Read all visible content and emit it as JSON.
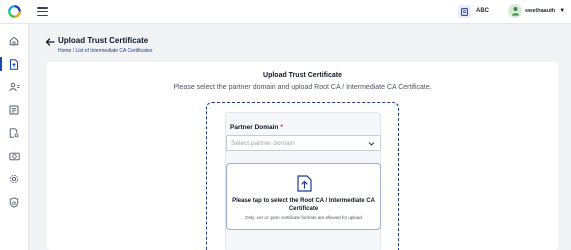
{
  "topbar": {
    "logo_icon": "colorful-ring-logo-icon",
    "menu_icon": "hamburger-menu-icon",
    "org_icon": "document-icon",
    "org_label": "ABC",
    "user_icon": "user-avatar-icon",
    "username": "swethaauth",
    "caret": "▼"
  },
  "sidebar": {
    "items": [
      {
        "icon": "home-icon",
        "active": false
      },
      {
        "icon": "file-upload-icon",
        "active": true
      },
      {
        "icon": "users-icon",
        "active": false
      },
      {
        "icon": "document-list-icon",
        "active": false
      },
      {
        "icon": "document-settings-icon",
        "active": false
      },
      {
        "icon": "camera-icon",
        "active": false
      },
      {
        "icon": "settings-icon",
        "active": false
      },
      {
        "icon": "shield-icon",
        "active": false
      }
    ]
  },
  "header": {
    "title": "Upload Trust Certificate",
    "breadcrumb_home": "Home",
    "breadcrumb_sep": " / ",
    "breadcrumb_current": "List of Intermediate CA Certificates"
  },
  "form": {
    "title": "Upload Trust Certificate",
    "subtitle": "Please select the partner domain and upload Root CA / Intermediate CA Certificate.",
    "partner_domain_label": "Partner Domain",
    "required_mark": "*",
    "select_placeholder": "Select partner domain",
    "upload_line1": "Please tap to select the Root CA / Intermediate CA",
    "upload_line2": "Certificate",
    "upload_note": "Only .cer or .pem certificate formats are allowed for upload"
  },
  "colors": {
    "accent": "#1e3a8a",
    "required": "#dc2626",
    "background": "#f2f3f5"
  }
}
